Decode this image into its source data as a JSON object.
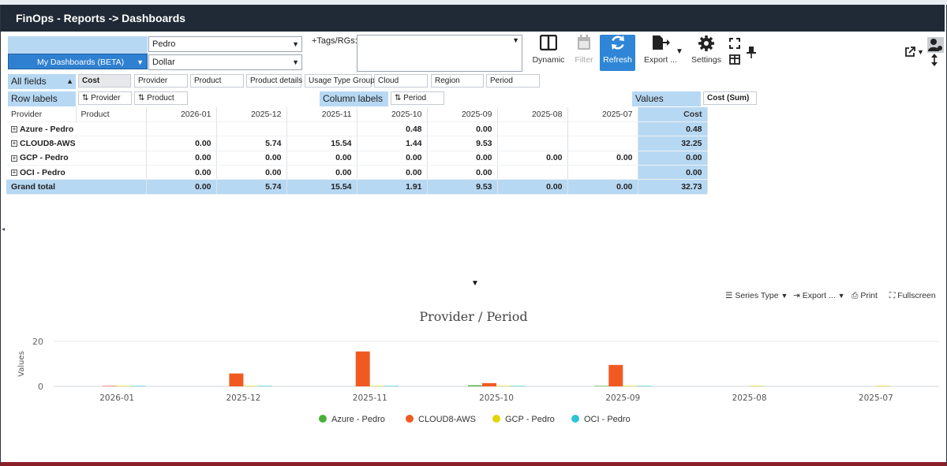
{
  "app": {
    "title": "FinOps - Reports -> Dashboards"
  },
  "controls": {
    "dashboard_select": "My Dashboards (BETA)",
    "user_select": "Pedro",
    "currency_select": "Dollar",
    "tags_label": "+Tags/RGs:",
    "tags_value": ""
  },
  "toolbar": {
    "dynamic": "Dynamic",
    "filter": "Filter",
    "refresh": "Refresh",
    "export": "Export ...",
    "settings": "Settings"
  },
  "fields": {
    "all_fields_label": "All fields",
    "available": [
      "Cost",
      "Provider",
      "Product",
      "Product details",
      "Usage Type Group",
      "Cloud",
      "Region",
      "Period"
    ],
    "row_labels_label": "Row labels",
    "row_fields": [
      "Provider",
      "Product"
    ],
    "column_labels_label": "Column labels",
    "column_fields": [
      "Period"
    ],
    "values_label": "Values",
    "value_fields": [
      "Cost (Sum)"
    ]
  },
  "pivot": {
    "row_headers": [
      "Provider",
      "Product"
    ],
    "columns": [
      "2026-01",
      "2025-12",
      "2025-11",
      "2025-10",
      "2025-09",
      "2025-08",
      "2025-07"
    ],
    "total_header": "Cost",
    "rows": [
      {
        "label": "Azure - Pedro",
        "values": [
          "",
          "",
          "",
          "0.48",
          "0.00",
          "",
          ""
        ],
        "total": "0.48"
      },
      {
        "label": "CLOUD8-AWS",
        "values": [
          "0.00",
          "5.74",
          "15.54",
          "1.44",
          "9.53",
          "",
          ""
        ],
        "total": "32.25"
      },
      {
        "label": "GCP - Pedro",
        "values": [
          "0.00",
          "0.00",
          "0.00",
          "0.00",
          "0.00",
          "0.00",
          "0.00"
        ],
        "total": "0.00"
      },
      {
        "label": "OCI - Pedro",
        "values": [
          "0.00",
          "0.00",
          "0.00",
          "0.00",
          "0.00",
          "",
          ""
        ],
        "total": "0.00"
      }
    ],
    "grand_total": {
      "label": "Grand total",
      "values": [
        "0.00",
        "5.74",
        "15.54",
        "1.91",
        "9.53",
        "0.00",
        "0.00"
      ],
      "total": "32.73"
    }
  },
  "chart_toolbar": {
    "series_type": "Series Type",
    "export": "Export ...",
    "print": "Print",
    "fullscreen": "Fullscreen"
  },
  "chart_data": {
    "type": "bar",
    "title": "Provider / Period",
    "xlabel": "",
    "ylabel": "Values",
    "ylim": [
      0,
      20
    ],
    "yticks": [
      0,
      20
    ],
    "grid": true,
    "legend_position": "bottom",
    "categories": [
      "2026-01",
      "2025-12",
      "2025-11",
      "2025-10",
      "2025-09",
      "2025-08",
      "2025-07"
    ],
    "series": [
      {
        "name": "Azure - Pedro",
        "color": "#4caf3a",
        "values": [
          null,
          null,
          null,
          0.48,
          0.0,
          null,
          null
        ]
      },
      {
        "name": "CLOUD8-AWS",
        "color": "#f05a22",
        "values": [
          0.0,
          5.74,
          15.54,
          1.44,
          9.53,
          null,
          null
        ]
      },
      {
        "name": "GCP - Pedro",
        "color": "#e3d400",
        "values": [
          0.0,
          0.0,
          0.0,
          0.0,
          0.0,
          0.0,
          0.0
        ]
      },
      {
        "name": "OCI - Pedro",
        "color": "#2ec4d6",
        "values": [
          0.0,
          0.0,
          0.0,
          0.0,
          0.0,
          null,
          null
        ]
      }
    ]
  }
}
